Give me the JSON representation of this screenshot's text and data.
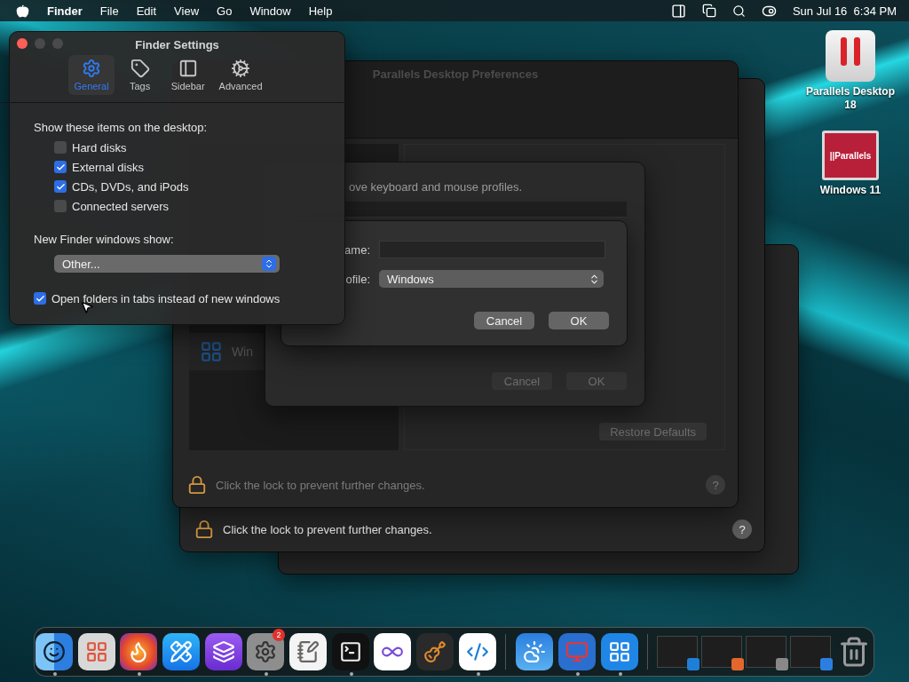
{
  "menu_bar": {
    "app_name": "Finder",
    "menus": [
      "File",
      "Edit",
      "View",
      "Go",
      "Window",
      "Help"
    ],
    "clock": "Sun Jul 16  6:34 PM"
  },
  "desktop_icons": [
    {
      "kind": "drive",
      "label": "Parallels Desktop 18"
    },
    {
      "kind": "vm",
      "label": "Windows 11",
      "screen_text": "||Parallels"
    }
  ],
  "back_window": {
    "lock_text": "Click the lock to prevent further changes.",
    "help_label": "?"
  },
  "preferences_window": {
    "title": "Parallels Desktop Preferences",
    "sidebar_items": [
      {
        "label": "Win"
      }
    ],
    "restore_button": "Restore Defaults",
    "lock_text": "Click the lock to prevent further changes.",
    "help_label": "?"
  },
  "profiles_sheet": {
    "text": "ove keyboard and mouse profiles.",
    "buttons": [
      "Cancel",
      "OK"
    ]
  },
  "new_profile_sheet": {
    "name_label": "ame:",
    "profile_label": "ofile:",
    "profile_value": "Windows",
    "buttons": [
      "Cancel",
      "OK"
    ]
  },
  "finder_settings": {
    "title": "Finder Settings",
    "tabs": [
      {
        "kind": "gear",
        "label": "General",
        "selected": true
      },
      {
        "kind": "tag",
        "label": "Tags",
        "selected": false
      },
      {
        "kind": "sidebar",
        "label": "Sidebar",
        "selected": false
      },
      {
        "kind": "gears",
        "label": "Advanced",
        "selected": false
      }
    ],
    "desktop_heading": "Show these items on the desktop:",
    "desktop_items": [
      {
        "label": "Hard disks",
        "checked": false
      },
      {
        "label": "External disks",
        "checked": true
      },
      {
        "label": "CDs, DVDs, and iPods",
        "checked": true
      },
      {
        "label": "Connected servers",
        "checked": false
      }
    ],
    "new_windows_label": "New Finder windows show:",
    "new_windows_value": "Other...",
    "open_in_tabs": {
      "label": "Open folders in tabs instead of new windows",
      "checked": true
    }
  },
  "dock": {
    "apps": [
      {
        "kind": "finder",
        "running": true
      },
      {
        "kind": "launchpad",
        "running": false
      },
      {
        "kind": "firefox",
        "running": true
      },
      {
        "kind": "appstore",
        "running": false
      },
      {
        "kind": "purple",
        "running": false
      },
      {
        "kind": "settings",
        "running": true,
        "badge": "2"
      },
      {
        "kind": "textedit",
        "running": false
      },
      {
        "kind": "terminal",
        "running": true
      },
      {
        "kind": "visualstudio",
        "running": false
      },
      {
        "kind": "garageband",
        "running": false
      },
      {
        "kind": "vscode",
        "running": true
      }
    ],
    "pinned": [
      {
        "kind": "weather",
        "running": false
      },
      {
        "kind": "parallels",
        "running": true
      },
      {
        "kind": "windows",
        "running": true
      }
    ],
    "minimized": [
      {
        "kind": "code"
      },
      {
        "kind": "firefox"
      },
      {
        "kind": "settings"
      },
      {
        "kind": "finder"
      }
    ]
  }
}
